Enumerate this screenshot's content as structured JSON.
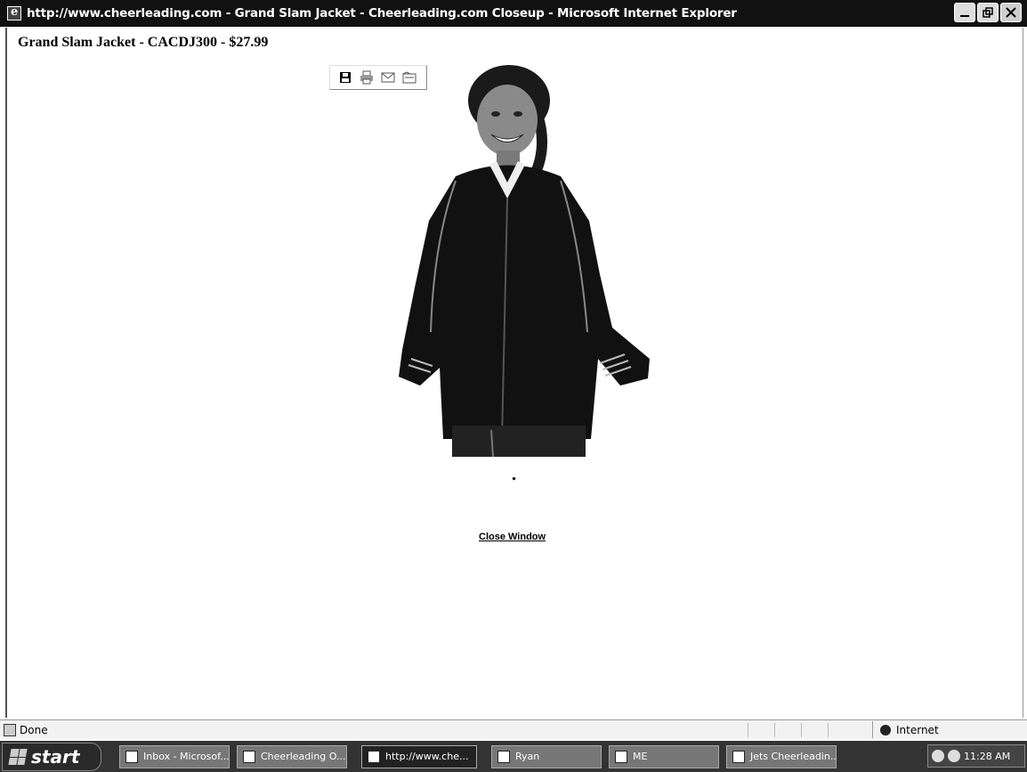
{
  "window": {
    "title": "http://www.cheerleading.com - Grand Slam Jacket - Cheerleading.com Closeup - Microsoft Internet Explorer",
    "controls": [
      "minimize",
      "restore",
      "close"
    ]
  },
  "page": {
    "heading": "Grand Slam Jacket - CACDJ300 - $27.99",
    "image_toolbar": [
      "save-icon",
      "print-icon",
      "email-icon",
      "folder-icon"
    ],
    "product_image_alt": "Grand Slam Jacket",
    "close_link": "Close Window"
  },
  "statusbar": {
    "status": "Done",
    "zone": "Internet"
  },
  "taskbar": {
    "start": "start",
    "tasks": [
      {
        "label": "Inbox - Microsof...",
        "active": false
      },
      {
        "label": "Cheerleading O...",
        "active": false
      },
      {
        "label": "http://www.che...",
        "active": true
      },
      {
        "label": "Ryan",
        "active": false
      },
      {
        "label": "ME",
        "active": false
      },
      {
        "label": "Jets Cheerleadin...",
        "active": false
      }
    ],
    "clock": "11:28 AM"
  }
}
